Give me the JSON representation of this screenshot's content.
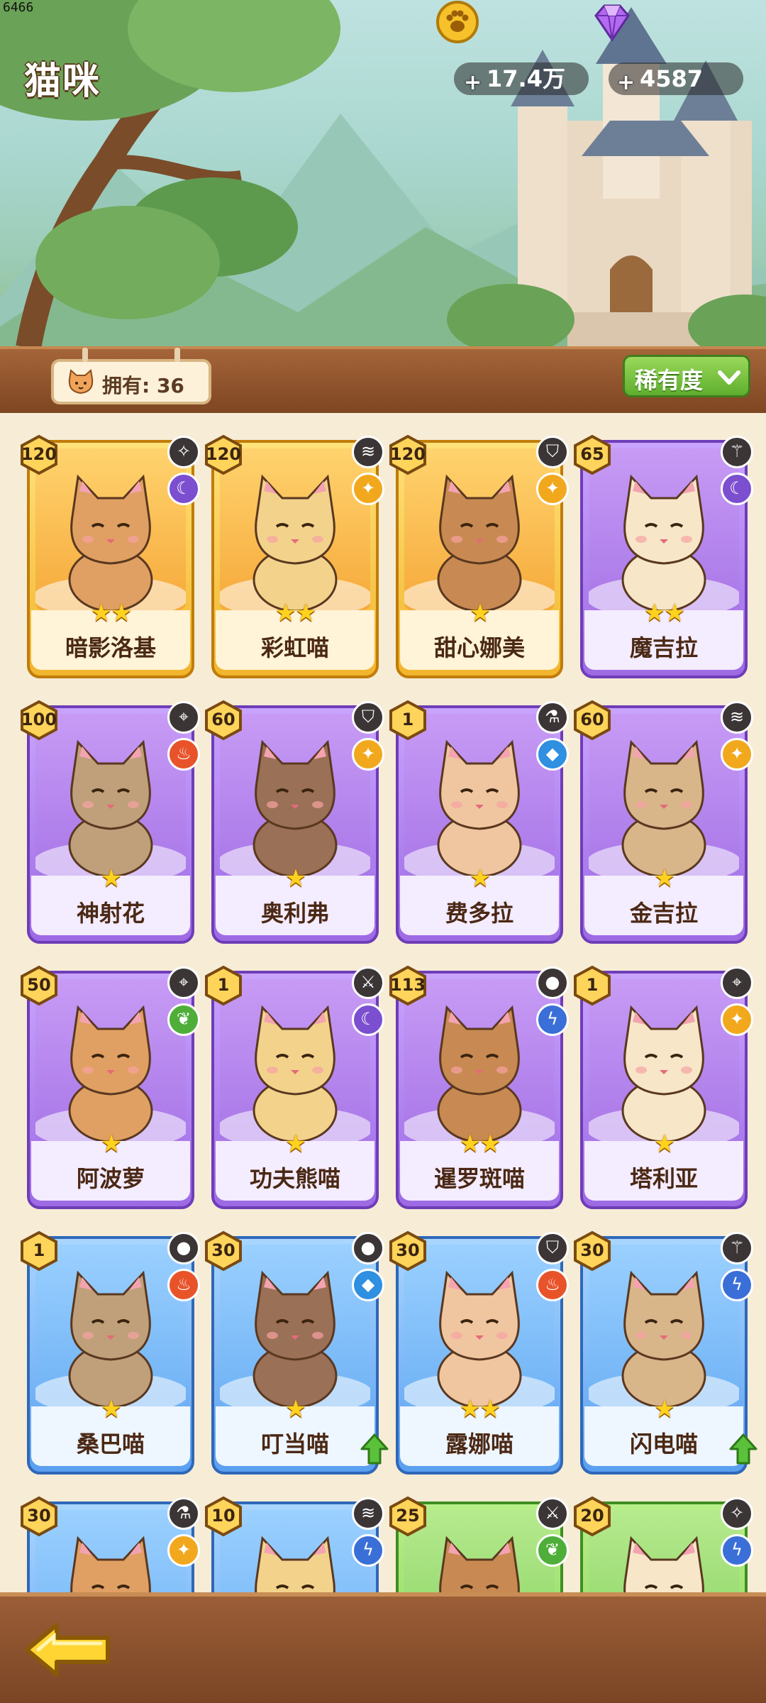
{
  "debug": {
    "fps_counter": "6466"
  },
  "header": {
    "title": "猫咪",
    "currency": [
      {
        "icon": "paw-coin-icon",
        "value": "17.4万",
        "add": "+"
      },
      {
        "icon": "purple-gem-icon",
        "value": "4587",
        "add": "+"
      }
    ]
  },
  "toolbar": {
    "owned_label": "拥有: 36",
    "sort_label": "稀有度"
  },
  "colors": {
    "gold_frame": "#f1b52c",
    "purple_frame": "#a776e6",
    "blue_frame": "#5a9ff0",
    "green_frame": "#7fcf55",
    "sort_button": "#6fbf35"
  },
  "cards": [
    {
      "name": "暗影洛基",
      "level": "120",
      "stars": "★★",
      "rarity": "gold",
      "role_icon": "spark-icon",
      "element_icon": "moon-icon"
    },
    {
      "name": "彩虹喵",
      "level": "120",
      "stars": "★★",
      "rarity": "gold",
      "role_icon": "wave-icon",
      "element_icon": "star-icon"
    },
    {
      "name": "甜心娜美",
      "level": "120",
      "stars": "★",
      "rarity": "gold",
      "role_icon": "shield-icon",
      "element_icon": "star-icon"
    },
    {
      "name": "魔吉拉",
      "level": "65",
      "stars": "★★",
      "rarity": "purple",
      "role_icon": "wand-icon",
      "element_icon": "moon-icon"
    },
    {
      "name": "神射花",
      "level": "100",
      "stars": "★",
      "rarity": "purple",
      "role_icon": "crosshair-icon",
      "element_icon": "fire-icon"
    },
    {
      "name": "奥利弗",
      "level": "60",
      "stars": "★",
      "rarity": "purple",
      "role_icon": "shield-icon",
      "element_icon": "star-icon"
    },
    {
      "name": "费多拉",
      "level": "1",
      "stars": "★",
      "rarity": "purple",
      "role_icon": "potion-icon",
      "element_icon": "water-icon"
    },
    {
      "name": "金吉拉",
      "level": "60",
      "stars": "★",
      "rarity": "purple",
      "role_icon": "wave-icon",
      "element_icon": "star-icon"
    },
    {
      "name": "阿波萝",
      "level": "50",
      "stars": "★",
      "rarity": "purple",
      "role_icon": "crosshair-icon",
      "element_icon": "leaf-icon"
    },
    {
      "name": "功夫熊喵",
      "level": "1",
      "stars": "★",
      "rarity": "purple",
      "role_icon": "sword-icon",
      "element_icon": "moon-icon"
    },
    {
      "name": "暹罗斑喵",
      "level": "113",
      "stars": "★★",
      "rarity": "purple",
      "role_icon": "bomb-icon",
      "element_icon": "lightning-icon"
    },
    {
      "name": "塔利亚",
      "level": "1",
      "stars": "★",
      "rarity": "purple",
      "role_icon": "crosshair-icon",
      "element_icon": "star-icon"
    },
    {
      "name": "桑巴喵",
      "level": "1",
      "stars": "★",
      "rarity": "blue",
      "role_icon": "bomb-icon",
      "element_icon": "fire-icon"
    },
    {
      "name": "叮当喵",
      "level": "30",
      "stars": "★",
      "rarity": "blue",
      "role_icon": "bomb-icon",
      "element_icon": "water-icon",
      "upgrade": true
    },
    {
      "name": "露娜喵",
      "level": "30",
      "stars": "★★",
      "rarity": "blue",
      "role_icon": "shield-icon",
      "element_icon": "fire-icon"
    },
    {
      "name": "闪电喵",
      "level": "30",
      "stars": "★",
      "rarity": "blue",
      "role_icon": "wand-icon",
      "element_icon": "lightning-icon",
      "upgrade": true
    },
    {
      "name": "",
      "level": "30",
      "stars": "",
      "rarity": "blue",
      "role_icon": "potion-icon",
      "element_icon": "star-icon"
    },
    {
      "name": "",
      "level": "10",
      "stars": "",
      "rarity": "blue",
      "role_icon": "wave-icon",
      "element_icon": "lightning-icon"
    },
    {
      "name": "",
      "level": "25",
      "stars": "",
      "rarity": "green",
      "role_icon": "sword-icon",
      "element_icon": "leaf-icon"
    },
    {
      "name": "",
      "level": "20",
      "stars": "",
      "rarity": "green",
      "role_icon": "spark-icon",
      "element_icon": "lightning-icon"
    }
  ],
  "footer": {
    "back_icon": "back-arrow-icon"
  }
}
